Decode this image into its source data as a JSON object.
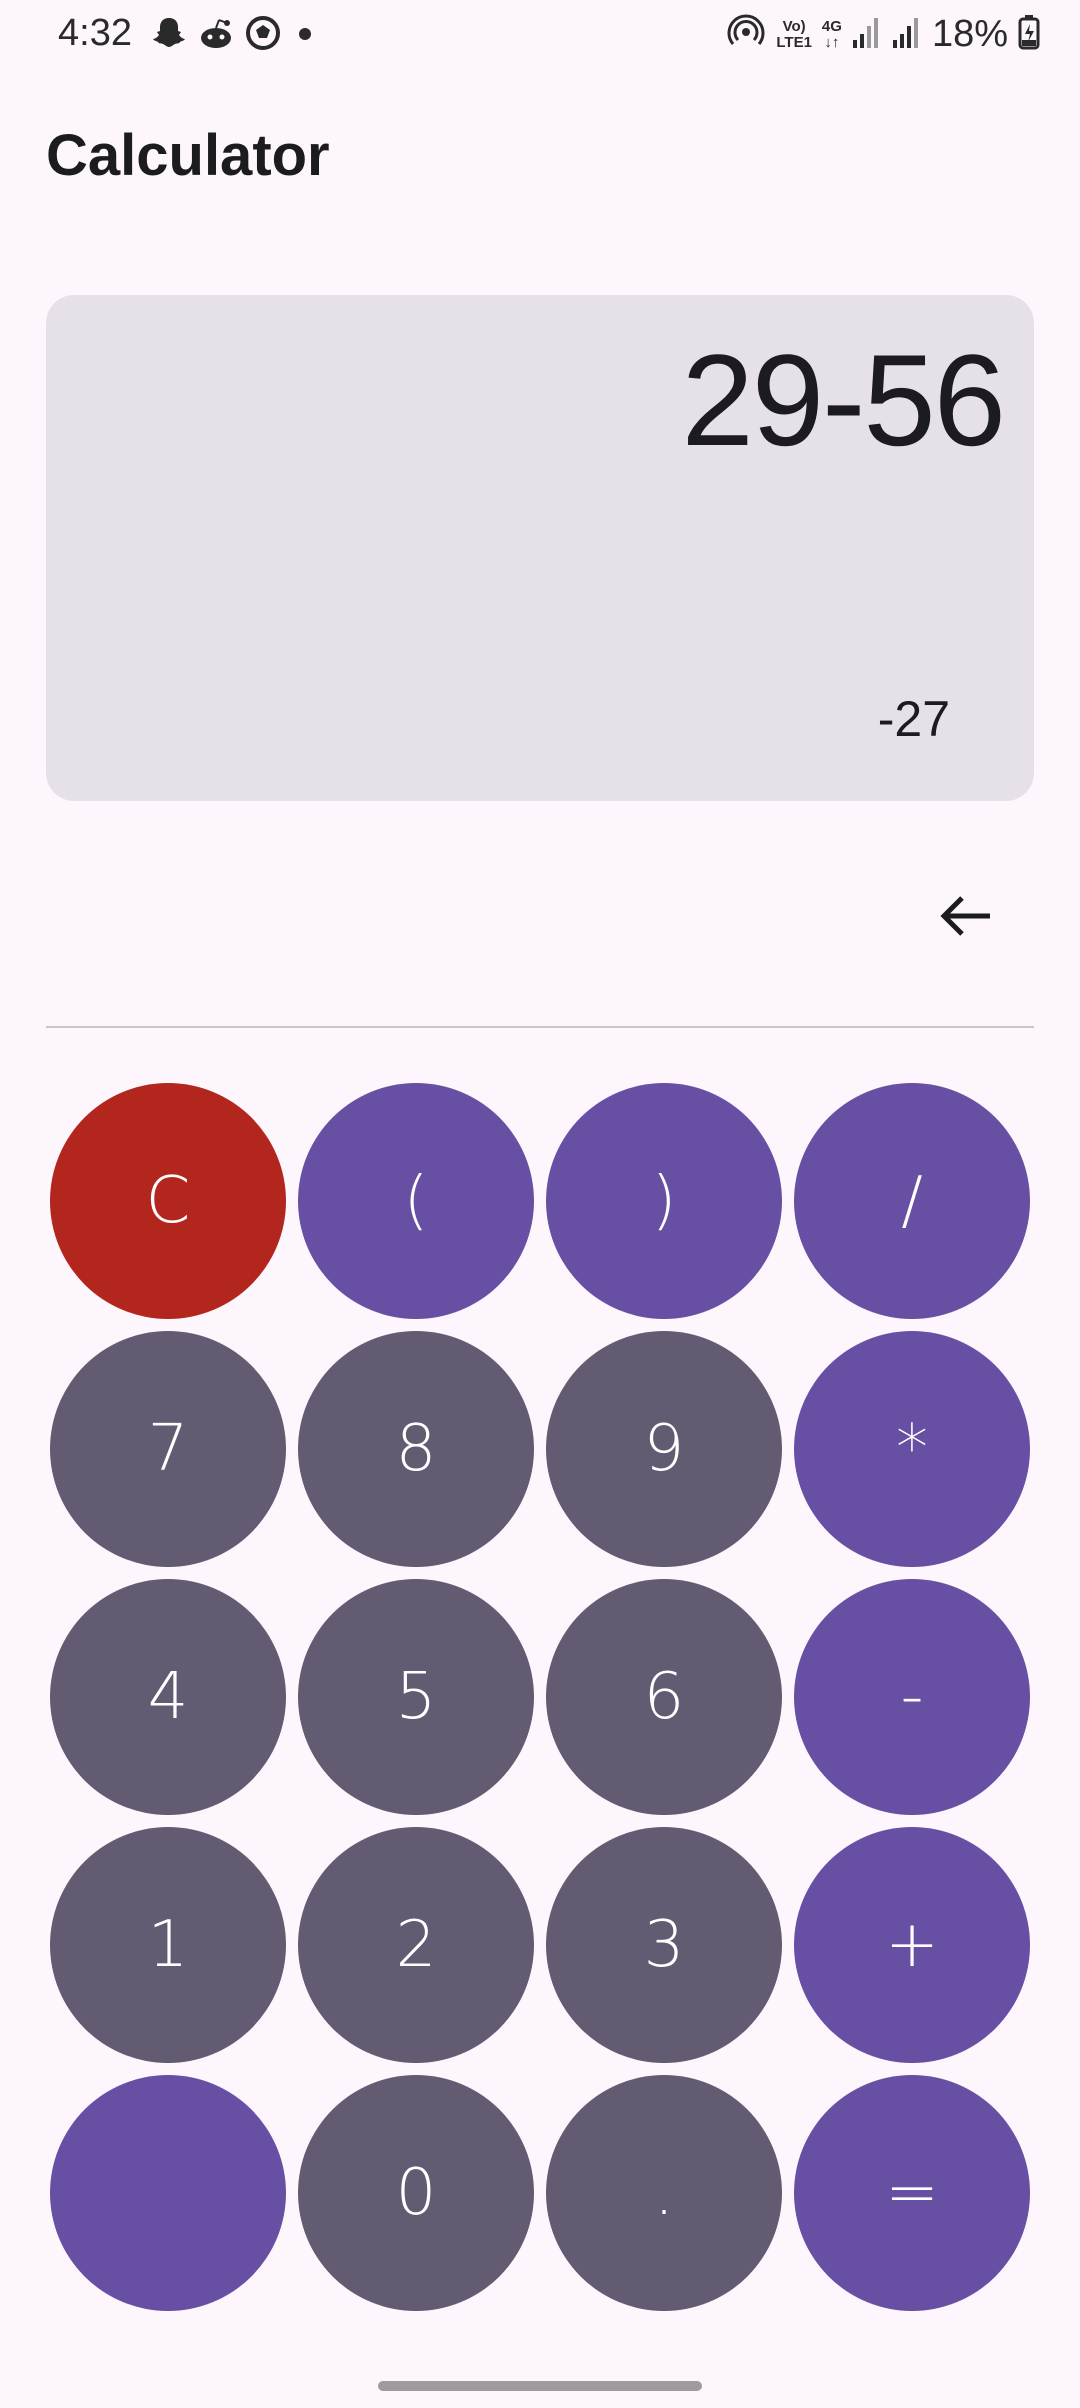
{
  "status_bar": {
    "time": "4:32",
    "network_top": "Vo)",
    "network_bottom": "LTE1",
    "network_type": "4G",
    "battery": "18%",
    "notification_icons": [
      "snapchat-icon",
      "reddit-icon",
      "soccer-ball-icon",
      "dot-icon"
    ],
    "system_icons": [
      "hotspot-icon",
      "signal-icon",
      "signal-icon",
      "battery-charging-icon"
    ]
  },
  "header": {
    "title": "Calculator"
  },
  "display": {
    "expression": "29-56",
    "result": "-27"
  },
  "backspace": {
    "icon": "backspace-arrow-icon"
  },
  "keypad": {
    "rows": [
      [
        "C",
        "(",
        ")",
        "/"
      ],
      [
        "7",
        "8",
        "9",
        "*"
      ],
      [
        "4",
        "5",
        "6",
        "-"
      ],
      [
        "1",
        "2",
        "3",
        "+"
      ],
      [
        "",
        "0",
        ".",
        "="
      ]
    ]
  },
  "colors": {
    "background": "#fdf7fd",
    "display_bg": "#e6e0e8",
    "operator": "#6750a4",
    "number": "#625b71",
    "clear": "#b3261e"
  }
}
